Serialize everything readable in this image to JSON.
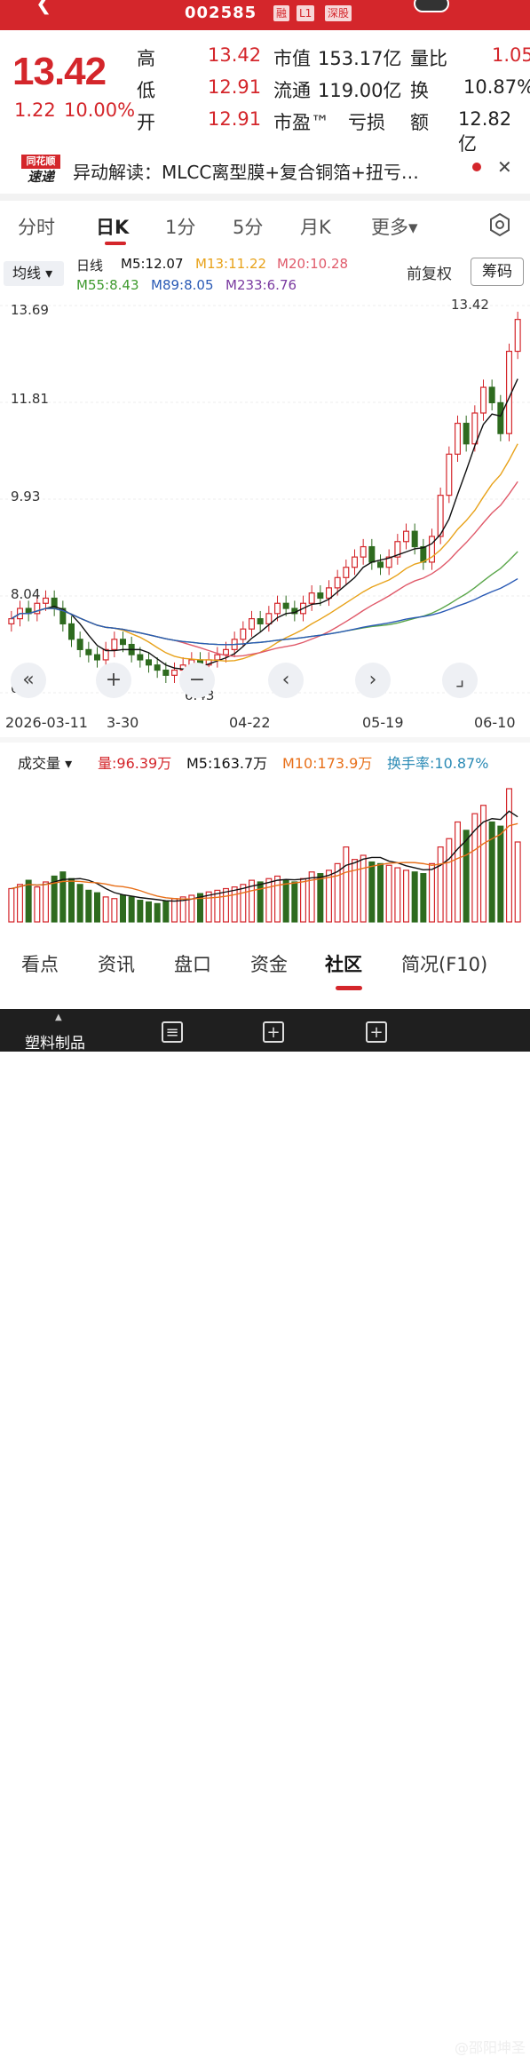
{
  "header": {
    "code": "002585",
    "tags": [
      "融",
      "L1",
      "深股"
    ]
  },
  "price": {
    "last": "13.42",
    "change": "1.22",
    "pct": "10.00%"
  },
  "quote": {
    "high_label": "高",
    "high": "13.42",
    "low_label": "低",
    "low": "12.91",
    "open_label": "开",
    "open": "12.91",
    "mcap_label": "市值",
    "mcap": "153.17亿",
    "float_label": "流通",
    "float": "119.00亿",
    "pe_label": "市盈™",
    "pe": "亏损",
    "volratio_label": "量比",
    "volratio": "1.05",
    "turnover_label": "换",
    "turnover": "10.87%",
    "amount_label": "额",
    "amount": "12.82亿"
  },
  "news": {
    "logo_top": "同花顺",
    "logo_bottom": "速递",
    "text": "异动解读：MLCC离型膜+复合铜箔+扭亏…"
  },
  "tabs": [
    "分时",
    "日K",
    "1分",
    "5分",
    "月K",
    "更多▾"
  ],
  "ma_bar": {
    "selector": "均线 ▾",
    "label": "日线",
    "m5": "M5:12.07",
    "m13": "M13:11.22",
    "m20": "M20:10.28",
    "m55": "M55:8.43",
    "m89": "M89:8.05",
    "m233": "M233:6.76",
    "fuquan": "前复权",
    "chouma": "筹码"
  },
  "axis": {
    "y": [
      "13.69",
      "11.81",
      "9.93",
      "8.04",
      "6.16"
    ],
    "x": [
      "2026-03-11",
      "3-30",
      "04-22",
      "05-19",
      "06-10"
    ],
    "hi_label": "13.42",
    "lo_label": "6.43"
  },
  "volume_bar": {
    "selector": "成交量 ▾",
    "vol": "量:96.39万",
    "m5": "M5:163.7万",
    "m10": "M10:173.9万",
    "turnover": "换手率:10.87%"
  },
  "bottom_tabs": [
    "看点",
    "资讯",
    "盘口",
    "资金",
    "社区",
    "简况(F10)"
  ],
  "navbar": {
    "label": "塑料制品",
    "weibo": "@邵阳坤圣"
  },
  "colors": {
    "up": "#d4262b",
    "down": "#2e6b1f",
    "m5": "#111111",
    "m13": "#e8a21a",
    "m20": "#e05a6a",
    "m55": "#5aa64a",
    "m89": "#2a5ab5",
    "m233": "#7a3aa0"
  },
  "chart_data": {
    "type": "candlestick",
    "title": "",
    "xlabel": "",
    "ylabel": "",
    "ylim": [
      6.16,
      13.69
    ],
    "x_ticks": [
      "2026-03-11",
      "3-30",
      "04-22",
      "05-19",
      "06-10"
    ],
    "series": [
      {
        "name": "K",
        "ohlc_close": [
          7.6,
          7.8,
          7.7,
          7.9,
          8.0,
          7.8,
          7.5,
          7.2,
          7.0,
          6.9,
          6.8,
          7.0,
          7.2,
          7.1,
          6.9,
          6.8,
          6.7,
          6.6,
          6.5,
          6.6,
          6.7,
          6.8,
          6.7,
          6.8,
          6.9,
          7.0,
          7.2,
          7.4,
          7.6,
          7.5,
          7.7,
          7.9,
          7.8,
          7.7,
          7.9,
          8.1,
          8.0,
          8.2,
          8.4,
          8.6,
          8.8,
          9.0,
          8.7,
          8.6,
          8.8,
          9.1,
          9.3,
          9.0,
          8.7,
          9.2,
          10.0,
          10.8,
          11.4,
          11.0,
          11.6,
          12.1,
          11.8,
          11.2,
          12.8,
          13.42
        ]
      },
      {
        "name": "量",
        "values": [
          40,
          45,
          50,
          42,
          48,
          55,
          60,
          52,
          45,
          38,
          35,
          30,
          28,
          32,
          30,
          26,
          24,
          22,
          25,
          28,
          30,
          32,
          34,
          36,
          38,
          40,
          42,
          45,
          50,
          48,
          52,
          55,
          50,
          48,
          52,
          60,
          58,
          62,
          70,
          90,
          75,
          80,
          72,
          70,
          68,
          65,
          62,
          60,
          58,
          70,
          90,
          100,
          120,
          110,
          130,
          140,
          120,
          115,
          160,
          96
        ]
      }
    ]
  }
}
